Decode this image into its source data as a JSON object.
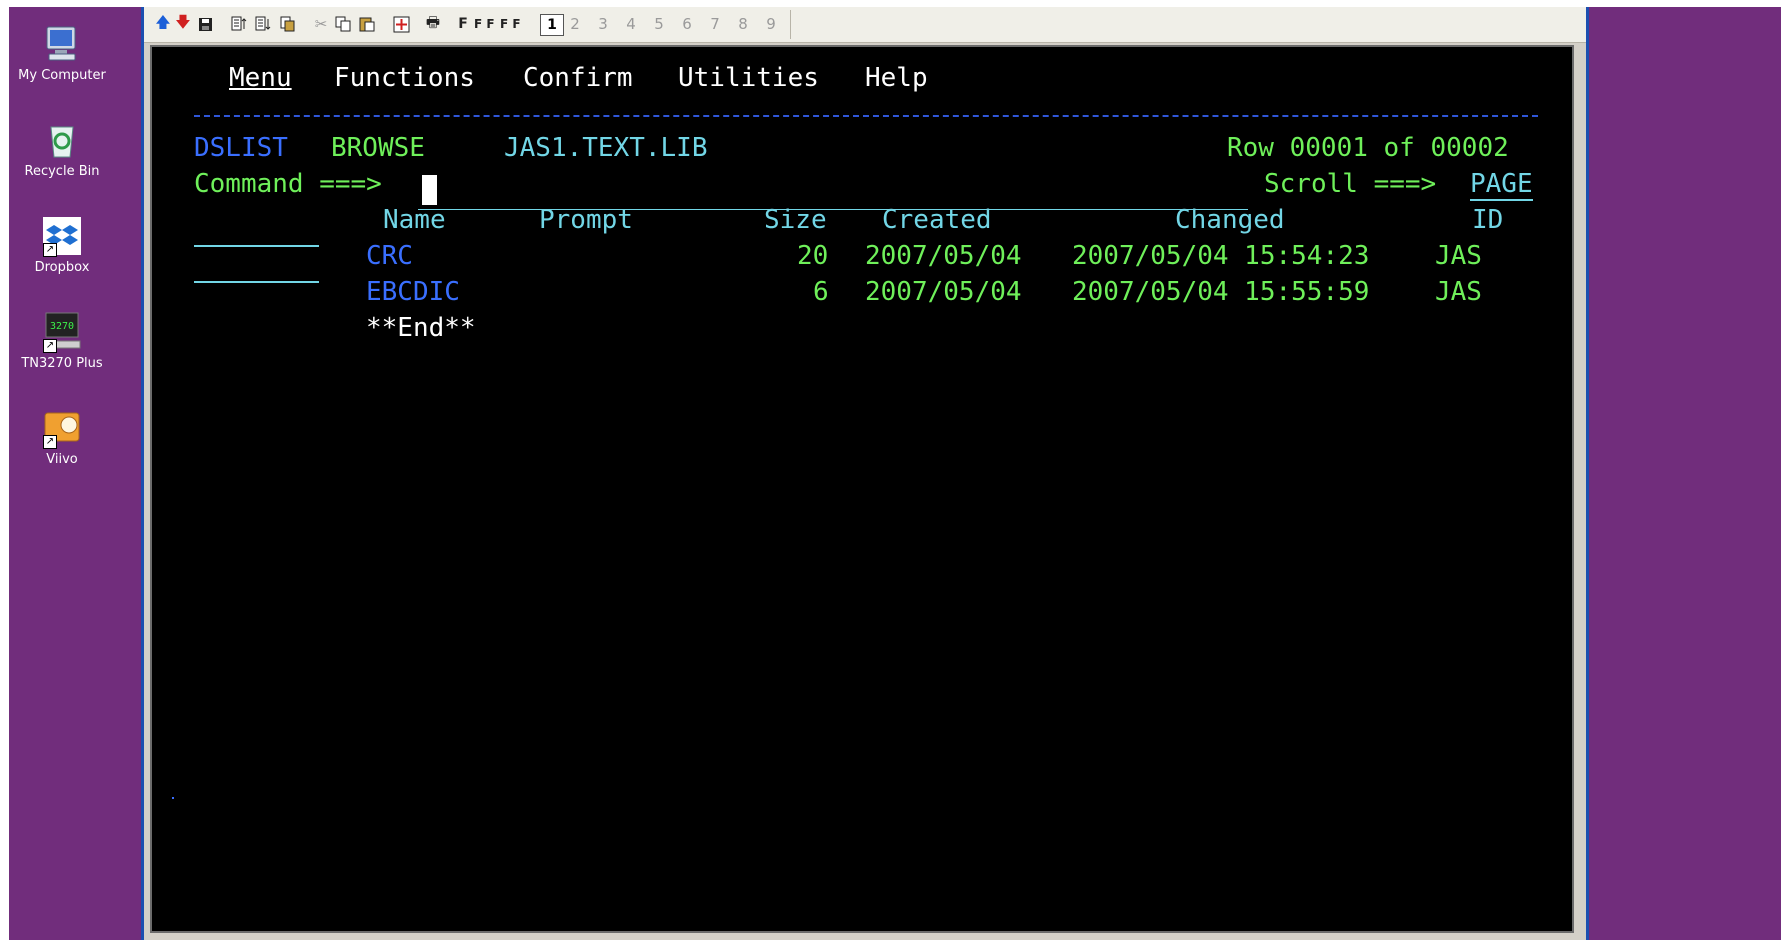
{
  "desktop": {
    "icons": [
      {
        "label": "My Computer",
        "icon": "my-computer-icon"
      },
      {
        "label": "Recycle Bin",
        "icon": "recycle-bin-icon"
      },
      {
        "label": "Dropbox",
        "icon": "dropbox-icon"
      },
      {
        "label": "TN3270 Plus",
        "icon": "terminal-3270-icon",
        "badge": "3270"
      },
      {
        "label": "Viivo",
        "icon": "viivo-icon"
      }
    ]
  },
  "toolbar": {
    "font_buttons": [
      "F",
      "F F",
      "F F"
    ],
    "sessions": [
      "1",
      "2",
      "3",
      "4",
      "5",
      "6",
      "7",
      "8",
      "9"
    ],
    "active_session": "1"
  },
  "menu": {
    "items": [
      {
        "label": "Menu"
      },
      {
        "label": "Functions"
      },
      {
        "label": "Confirm"
      },
      {
        "label": "Utilities"
      },
      {
        "label": "Help"
      }
    ]
  },
  "header": {
    "panel": "DSLIST",
    "mode": "BROWSE",
    "dataset": "JAS1.TEXT.LIB",
    "row_info": "Row 00001 of 00002"
  },
  "command": {
    "label": "Command ===>",
    "value": "",
    "scroll_label": "Scroll ===>",
    "scroll_value": "PAGE"
  },
  "table": {
    "headers": {
      "name": "Name",
      "prompt": "Prompt",
      "size": "Size",
      "created": "Created",
      "changed": "Changed",
      "id": "ID"
    },
    "rows": [
      {
        "name": "CRC",
        "prompt": "",
        "size": "20",
        "created": "2007/05/04",
        "changed": "2007/05/04 15:54:23",
        "id": "JAS"
      },
      {
        "name": "EBCDIC",
        "prompt": "",
        "size": "6",
        "created": "2007/05/04",
        "changed": "2007/05/04 15:55:59",
        "id": "JAS"
      }
    ],
    "end_marker": "**End**"
  },
  "colors": {
    "desktop": "#712d7c",
    "terminal_bg": "#000000",
    "green": "#6ff05a",
    "cyan": "#72d6e6",
    "blue": "#3a6fff"
  }
}
